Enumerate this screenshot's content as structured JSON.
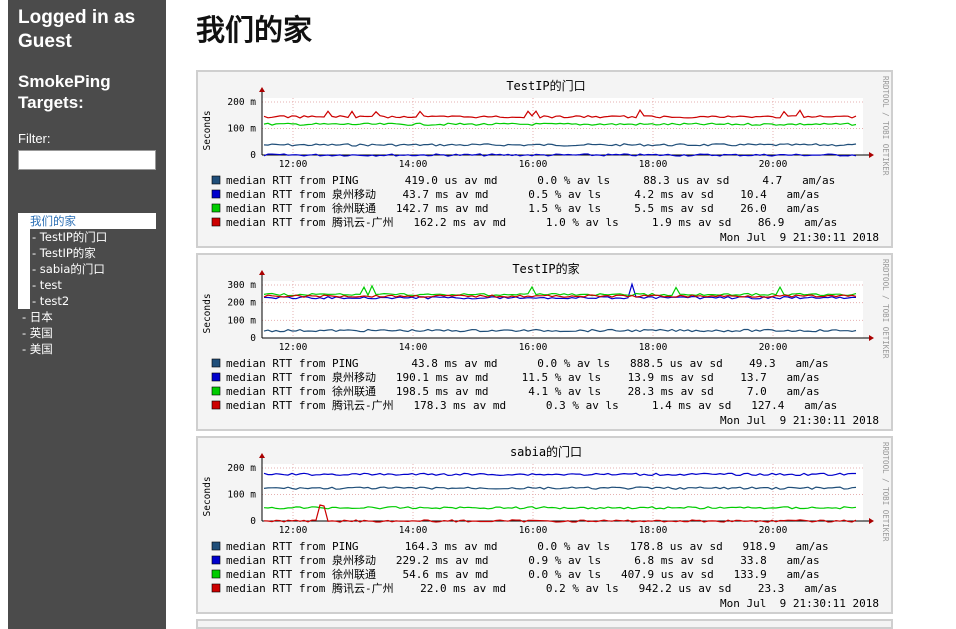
{
  "sidebar": {
    "login_text": "Logged in as Guest",
    "targets_title": "SmokePing Targets:",
    "filter_label": "Filter:",
    "filter_value": "",
    "menu": {
      "active": "我们的家",
      "subitems": [
        "- TestIP的门口",
        "- TestIP的家",
        "- sabia的门口",
        "- test",
        "- test2"
      ],
      "top_items": [
        "- 日本",
        "- 英国",
        "- 美国"
      ]
    }
  },
  "page_title": "我们的家",
  "graphs": [
    {
      "title": "TestIP的门口",
      "y_axis_label": "Seconds",
      "y_ticks": [
        "200 m",
        "100 m",
        "0"
      ],
      "x_ticks": [
        "12:00",
        "14:00",
        "16:00",
        "18:00",
        "20:00"
      ],
      "rrdtool_label": "RRDTOOL / TOBI OETIKER",
      "legend": [
        {
          "color": "#1f4e79",
          "text": "median RTT from PING       419.0 us av md      0.0 % av ls     88.3 us av sd     4.7   am/as"
        },
        {
          "color": "#0000cc",
          "text": "median RTT from 泉州移动    43.7 ms av md      0.5 % av ls     4.2 ms av sd    10.4   am/as"
        },
        {
          "color": "#00cc00",
          "text": "median RTT from 徐州联通   142.7 ms av md      1.5 % av ls     5.5 ms av sd    26.0   am/as"
        },
        {
          "color": "#cc0000",
          "text": "median RTT from 腾讯云-广州   162.2 ms av md      1.0 % av ls     1.9 ms av sd    86.9   am/as"
        }
      ],
      "timestamp": "Mon Jul  9 21:30:11 2018"
    },
    {
      "title": "TestIP的家",
      "y_axis_label": "Seconds",
      "y_ticks": [
        "300 m",
        "200 m",
        "100 m",
        "0"
      ],
      "x_ticks": [
        "12:00",
        "14:00",
        "16:00",
        "18:00",
        "20:00"
      ],
      "rrdtool_label": "RRDTOOL / TOBI OETIKER",
      "legend": [
        {
          "color": "#1f4e79",
          "text": "median RTT from PING        43.8 ms av md      0.0 % av ls   888.5 us av sd    49.3   am/as"
        },
        {
          "color": "#0000cc",
          "text": "median RTT from 泉州移动   190.1 ms av md     11.5 % av ls    13.9 ms av sd    13.7   am/as"
        },
        {
          "color": "#00cc00",
          "text": "median RTT from 徐州联通   198.5 ms av md      4.1 % av ls    28.3 ms av sd     7.0   am/as"
        },
        {
          "color": "#cc0000",
          "text": "median RTT from 腾讯云-广州   178.3 ms av md      0.3 % av ls     1.4 ms av sd   127.4   am/as"
        }
      ],
      "timestamp": "Mon Jul  9 21:30:11 2018"
    },
    {
      "title": "sabia的门口",
      "y_axis_label": "Seconds",
      "y_ticks": [
        "200 m",
        "100 m",
        "0"
      ],
      "x_ticks": [
        "12:00",
        "14:00",
        "16:00",
        "18:00",
        "20:00"
      ],
      "rrdtool_label": "RRDTOOL / TOBI OETIKER",
      "legend": [
        {
          "color": "#1f4e79",
          "text": "median RTT from PING       164.3 ms av md      0.0 % av ls   178.8 us av sd   918.9   am/as"
        },
        {
          "color": "#0000cc",
          "text": "median RTT from 泉州移动   229.2 ms av md      0.9 % av ls     6.8 ms av sd    33.8   am/as"
        },
        {
          "color": "#00cc00",
          "text": "median RTT from 徐州联通    54.6 ms av md      0.0 % av ls   407.9 us av sd   133.9   am/as"
        },
        {
          "color": "#cc0000",
          "text": "median RTT from 腾讯云-广州    22.0 ms av md      0.2 % av ls   942.2 us av sd    23.3   am/as"
        }
      ],
      "timestamp": "Mon Jul  9 21:30:11 2018"
    }
  ]
}
